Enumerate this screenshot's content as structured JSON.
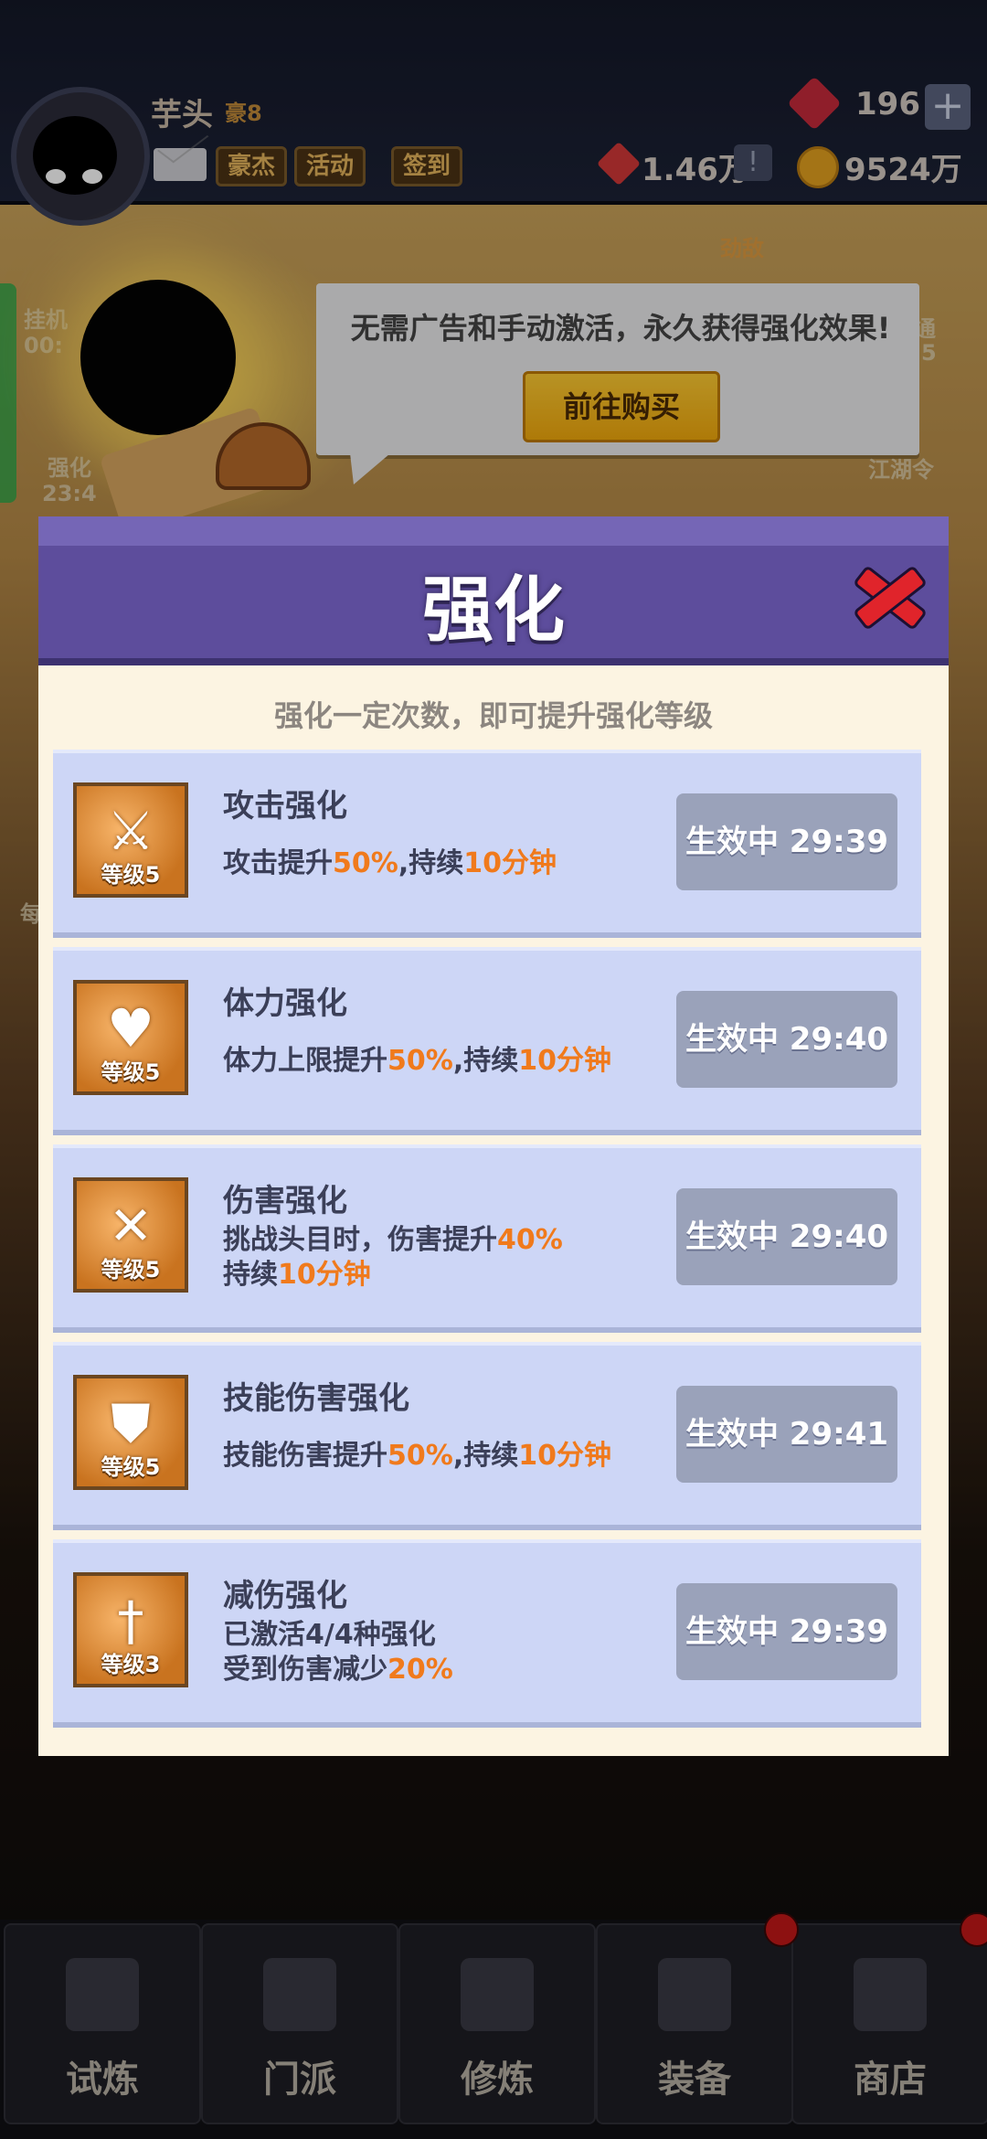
{
  "player": {
    "name": "芋头",
    "vip_label": "豪8"
  },
  "header": {
    "buttons": [
      "豪杰",
      "活动",
      "签到"
    ],
    "gems": "196",
    "money": "1.46万",
    "coins": "9524万"
  },
  "left_labels": {
    "idle": "挂机",
    "idle_timer": "00:",
    "strengthen": "强化",
    "strengthen_timer": "23:4",
    "daily": "每"
  },
  "right_labels": {
    "enemy": "劲敌",
    "wanted": "通",
    "wanted_sub": "5",
    "jianghu": "江湖令"
  },
  "tooltip": {
    "text": "无需广告和手动激活，永久获得强化效果!",
    "button": "前往购买"
  },
  "modal": {
    "title": "强化",
    "subtitle": "强化一定次数，即可提升强化等级",
    "items": [
      {
        "icon": "sword-icon",
        "name": "攻击强化",
        "level": "等级5",
        "desc_pre": "攻击提升",
        "desc_hl": "50%",
        "desc_mid": ",持续",
        "desc_hl2": "10分钟",
        "status": "生效中 29:39"
      },
      {
        "icon": "heart-icon",
        "name": "体力强化",
        "level": "等级5",
        "desc_pre": "体力上限提升",
        "desc_hl": "50%",
        "desc_mid": ",持续",
        "desc_hl2": "10分钟",
        "status": "生效中 29:40"
      },
      {
        "icon": "crossed-swords-icon",
        "name": "伤害强化",
        "level": "等级5",
        "line1_pre": "挑战头目时，伤害提升",
        "line1_hl": "40%",
        "line2_pre": "持续",
        "line2_hl": "10分钟",
        "status": "生效中 29:40"
      },
      {
        "icon": "shield-icon",
        "name": "技能伤害强化",
        "level": "等级5",
        "desc_pre": "技能伤害提升",
        "desc_hl": "50%",
        "desc_mid": ",持续",
        "desc_hl2": "10分钟",
        "status": "生效中 29:41"
      },
      {
        "icon": "dagger-icon",
        "name": "减伤强化",
        "level": "等级3",
        "line1_pre": "已激活4/4种强化",
        "line1_hl": "",
        "line2_pre": "受到伤害减少",
        "line2_hl": "20%",
        "status": "生效中 29:39"
      }
    ]
  },
  "bottom_nav": [
    "试炼",
    "门派",
    "修炼",
    "装备",
    "商店"
  ],
  "colors": {
    "modal_header": "#5d4d9c",
    "card_bg": "#cdd6f6",
    "highlight": "#f07a1c",
    "status_button": "#9aa2ba",
    "buy_button": "#f2a90c"
  }
}
